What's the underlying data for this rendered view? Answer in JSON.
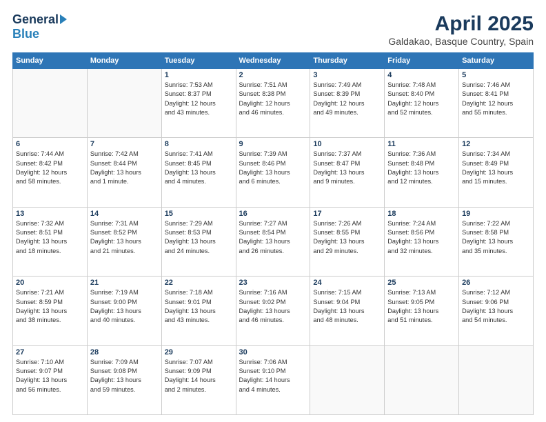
{
  "header": {
    "logo_general": "General",
    "logo_blue": "Blue",
    "month_title": "April 2025",
    "location": "Galdakao, Basque Country, Spain"
  },
  "weekdays": [
    "Sunday",
    "Monday",
    "Tuesday",
    "Wednesday",
    "Thursday",
    "Friday",
    "Saturday"
  ],
  "weeks": [
    [
      {
        "day": "",
        "info": ""
      },
      {
        "day": "",
        "info": ""
      },
      {
        "day": "1",
        "info": "Sunrise: 7:53 AM\nSunset: 8:37 PM\nDaylight: 12 hours\nand 43 minutes."
      },
      {
        "day": "2",
        "info": "Sunrise: 7:51 AM\nSunset: 8:38 PM\nDaylight: 12 hours\nand 46 minutes."
      },
      {
        "day": "3",
        "info": "Sunrise: 7:49 AM\nSunset: 8:39 PM\nDaylight: 12 hours\nand 49 minutes."
      },
      {
        "day": "4",
        "info": "Sunrise: 7:48 AM\nSunset: 8:40 PM\nDaylight: 12 hours\nand 52 minutes."
      },
      {
        "day": "5",
        "info": "Sunrise: 7:46 AM\nSunset: 8:41 PM\nDaylight: 12 hours\nand 55 minutes."
      }
    ],
    [
      {
        "day": "6",
        "info": "Sunrise: 7:44 AM\nSunset: 8:42 PM\nDaylight: 12 hours\nand 58 minutes."
      },
      {
        "day": "7",
        "info": "Sunrise: 7:42 AM\nSunset: 8:44 PM\nDaylight: 13 hours\nand 1 minute."
      },
      {
        "day": "8",
        "info": "Sunrise: 7:41 AM\nSunset: 8:45 PM\nDaylight: 13 hours\nand 4 minutes."
      },
      {
        "day": "9",
        "info": "Sunrise: 7:39 AM\nSunset: 8:46 PM\nDaylight: 13 hours\nand 6 minutes."
      },
      {
        "day": "10",
        "info": "Sunrise: 7:37 AM\nSunset: 8:47 PM\nDaylight: 13 hours\nand 9 minutes."
      },
      {
        "day": "11",
        "info": "Sunrise: 7:36 AM\nSunset: 8:48 PM\nDaylight: 13 hours\nand 12 minutes."
      },
      {
        "day": "12",
        "info": "Sunrise: 7:34 AM\nSunset: 8:49 PM\nDaylight: 13 hours\nand 15 minutes."
      }
    ],
    [
      {
        "day": "13",
        "info": "Sunrise: 7:32 AM\nSunset: 8:51 PM\nDaylight: 13 hours\nand 18 minutes."
      },
      {
        "day": "14",
        "info": "Sunrise: 7:31 AM\nSunset: 8:52 PM\nDaylight: 13 hours\nand 21 minutes."
      },
      {
        "day": "15",
        "info": "Sunrise: 7:29 AM\nSunset: 8:53 PM\nDaylight: 13 hours\nand 24 minutes."
      },
      {
        "day": "16",
        "info": "Sunrise: 7:27 AM\nSunset: 8:54 PM\nDaylight: 13 hours\nand 26 minutes."
      },
      {
        "day": "17",
        "info": "Sunrise: 7:26 AM\nSunset: 8:55 PM\nDaylight: 13 hours\nand 29 minutes."
      },
      {
        "day": "18",
        "info": "Sunrise: 7:24 AM\nSunset: 8:56 PM\nDaylight: 13 hours\nand 32 minutes."
      },
      {
        "day": "19",
        "info": "Sunrise: 7:22 AM\nSunset: 8:58 PM\nDaylight: 13 hours\nand 35 minutes."
      }
    ],
    [
      {
        "day": "20",
        "info": "Sunrise: 7:21 AM\nSunset: 8:59 PM\nDaylight: 13 hours\nand 38 minutes."
      },
      {
        "day": "21",
        "info": "Sunrise: 7:19 AM\nSunset: 9:00 PM\nDaylight: 13 hours\nand 40 minutes."
      },
      {
        "day": "22",
        "info": "Sunrise: 7:18 AM\nSunset: 9:01 PM\nDaylight: 13 hours\nand 43 minutes."
      },
      {
        "day": "23",
        "info": "Sunrise: 7:16 AM\nSunset: 9:02 PM\nDaylight: 13 hours\nand 46 minutes."
      },
      {
        "day": "24",
        "info": "Sunrise: 7:15 AM\nSunset: 9:04 PM\nDaylight: 13 hours\nand 48 minutes."
      },
      {
        "day": "25",
        "info": "Sunrise: 7:13 AM\nSunset: 9:05 PM\nDaylight: 13 hours\nand 51 minutes."
      },
      {
        "day": "26",
        "info": "Sunrise: 7:12 AM\nSunset: 9:06 PM\nDaylight: 13 hours\nand 54 minutes."
      }
    ],
    [
      {
        "day": "27",
        "info": "Sunrise: 7:10 AM\nSunset: 9:07 PM\nDaylight: 13 hours\nand 56 minutes."
      },
      {
        "day": "28",
        "info": "Sunrise: 7:09 AM\nSunset: 9:08 PM\nDaylight: 13 hours\nand 59 minutes."
      },
      {
        "day": "29",
        "info": "Sunrise: 7:07 AM\nSunset: 9:09 PM\nDaylight: 14 hours\nand 2 minutes."
      },
      {
        "day": "30",
        "info": "Sunrise: 7:06 AM\nSunset: 9:10 PM\nDaylight: 14 hours\nand 4 minutes."
      },
      {
        "day": "",
        "info": ""
      },
      {
        "day": "",
        "info": ""
      },
      {
        "day": "",
        "info": ""
      }
    ]
  ]
}
